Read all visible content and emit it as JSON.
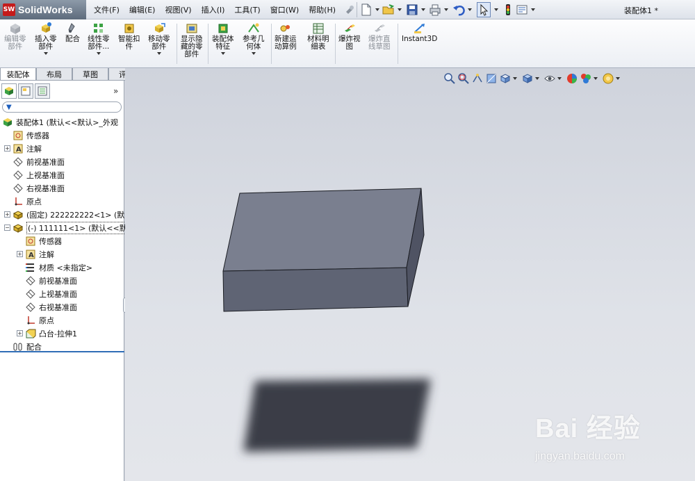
{
  "app": {
    "brand": "SolidWorks",
    "brand_badge": "SW",
    "document_title": "装配体1 *"
  },
  "menus": [
    "文件(F)",
    "编辑(E)",
    "视图(V)",
    "插入(I)",
    "工具(T)",
    "窗口(W)",
    "帮助(H)"
  ],
  "ribbon": [
    {
      "label": "编辑零\n部件",
      "disabled": true,
      "dropdown": false,
      "icon": "edit-component-icon"
    },
    {
      "label": "插入零\n部件",
      "disabled": false,
      "dropdown": true,
      "icon": "insert-component-icon"
    },
    {
      "label": "配合",
      "disabled": false,
      "dropdown": false,
      "icon": "mate-icon"
    },
    {
      "label": "线性零\n部件...",
      "disabled": false,
      "dropdown": true,
      "icon": "linear-pattern-icon"
    },
    {
      "label": "智能扣\n件",
      "disabled": false,
      "dropdown": false,
      "icon": "smart-fasteners-icon"
    },
    {
      "label": "移动零\n部件",
      "disabled": false,
      "dropdown": true,
      "icon": "move-component-icon"
    },
    {
      "label": "显示隐\n藏的零\n部件",
      "disabled": false,
      "dropdown": false,
      "icon": "show-hidden-icon"
    },
    {
      "label": "装配体\n特征",
      "disabled": false,
      "dropdown": true,
      "icon": "assembly-features-icon"
    },
    {
      "label": "参考几\n何体",
      "disabled": false,
      "dropdown": true,
      "icon": "reference-geometry-icon"
    },
    {
      "label": "新建运\n动算例",
      "disabled": false,
      "dropdown": false,
      "icon": "new-motion-study-icon"
    },
    {
      "label": "材料明\n细表",
      "disabled": false,
      "dropdown": false,
      "icon": "bill-of-materials-icon"
    },
    {
      "label": "爆炸视\n图",
      "disabled": false,
      "dropdown": false,
      "icon": "exploded-view-icon"
    },
    {
      "label": "爆炸直\n线草图",
      "disabled": true,
      "dropdown": false,
      "icon": "explode-line-sketch-icon"
    },
    {
      "label": "Instant3D",
      "disabled": false,
      "dropdown": false,
      "icon": "instant3d-icon"
    }
  ],
  "tabs": [
    "装配体",
    "布局",
    "草图",
    "评估"
  ],
  "tree": [
    {
      "label": "装配体1 (默认<<默认>_外观",
      "icon": "assembly-icon",
      "indent": 0,
      "expander": ""
    },
    {
      "label": "传感器",
      "icon": "sensor-icon",
      "indent": 1,
      "expander": ""
    },
    {
      "label": "注解",
      "icon": "annotation-icon",
      "indent": 1,
      "expander": "+"
    },
    {
      "label": "前视基准面",
      "icon": "plane-icon",
      "indent": 1,
      "expander": ""
    },
    {
      "label": "上视基准面",
      "icon": "plane-icon",
      "indent": 1,
      "expander": ""
    },
    {
      "label": "右视基准面",
      "icon": "plane-icon",
      "indent": 1,
      "expander": ""
    },
    {
      "label": "原点",
      "icon": "origin-icon",
      "indent": 1,
      "expander": ""
    },
    {
      "label": "(固定) 222222222<1> (默",
      "icon": "part-icon",
      "indent": 1,
      "expander": "+"
    },
    {
      "label": "(-) 111111<1> (默认<<默",
      "icon": "part-icon",
      "indent": 1,
      "expander": "−",
      "selected": true
    },
    {
      "label": "传感器",
      "icon": "sensor-icon",
      "indent": 2,
      "expander": ""
    },
    {
      "label": "注解",
      "icon": "annotation-icon",
      "indent": 2,
      "expander": "+"
    },
    {
      "label": "材质 <未指定>",
      "icon": "material-icon",
      "indent": 2,
      "expander": ""
    },
    {
      "label": "前视基准面",
      "icon": "plane-icon",
      "indent": 2,
      "expander": ""
    },
    {
      "label": "上视基准面",
      "icon": "plane-icon",
      "indent": 2,
      "expander": ""
    },
    {
      "label": "右视基准面",
      "icon": "plane-icon",
      "indent": 2,
      "expander": ""
    },
    {
      "label": "原点",
      "icon": "origin-icon",
      "indent": 2,
      "expander": ""
    },
    {
      "label": "凸台-拉伸1",
      "icon": "extrude-icon",
      "indent": 2,
      "expander": "+"
    },
    {
      "label": "配合",
      "icon": "mates-folder-icon",
      "indent": 1,
      "expander": ""
    }
  ],
  "watermark": {
    "brand": "Bai 经验",
    "url": "jingyan.baidu.com"
  },
  "colors": {
    "viewport_bg": "#d8dbe2",
    "part_top": "#7a7f8f",
    "part_front": "#5f6474",
    "part_side": "#4f5363",
    "shadow": "#3a3e47"
  }
}
